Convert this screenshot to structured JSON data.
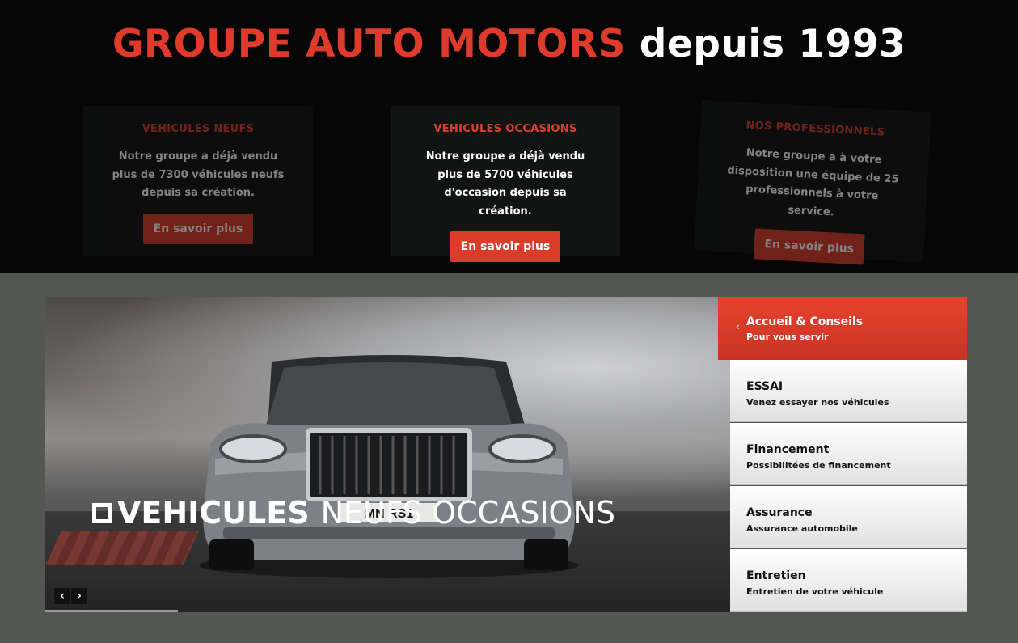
{
  "headline": {
    "brand": "GROUPE AUTO MOTORS",
    "since": "depuis 1993"
  },
  "cards": [
    {
      "title": "VEHICULES NEUFS",
      "line1": "Notre groupe a déjà vendu",
      "line2": "plus de 7300 véhicules neufs",
      "line3": "depuis sa création.",
      "button": "En savoir plus"
    },
    {
      "title": "VEHICULES OCCASIONS",
      "line1": "Notre groupe a déjà vendu",
      "line2": "plus de 5700 véhicules",
      "line3": "d'occasion depuis sa création.",
      "button": "En savoir plus"
    },
    {
      "title": "NOS PROFESSIONNELS",
      "line1": "Notre groupe a à votre",
      "line2": "disposition une équipe de 25",
      "line3": "professionnels à votre service.",
      "button": "En savoir plus"
    }
  ],
  "slider": {
    "caption_strong": "VEHICULES",
    "caption_light": "NEUFS OCCASIONS",
    "prev_icon": "chevron-left-icon",
    "next_icon": "chevron-right-icon",
    "plate": "MN RS1"
  },
  "menu": [
    {
      "title": "Accueil & Conseils",
      "subtitle": "Pour vous servir"
    },
    {
      "title": "ESSAI",
      "subtitle": "Venez essayer nos véhicules"
    },
    {
      "title": "Financement",
      "subtitle": "Possibilitées de financement"
    },
    {
      "title": "Assurance",
      "subtitle": "Assurance automobile"
    },
    {
      "title": "Entretien",
      "subtitle": "Entretien de votre véhicule"
    }
  ],
  "colors": {
    "accent": "#de3b2c",
    "top_background": "#060606",
    "page_background": "#545654"
  }
}
